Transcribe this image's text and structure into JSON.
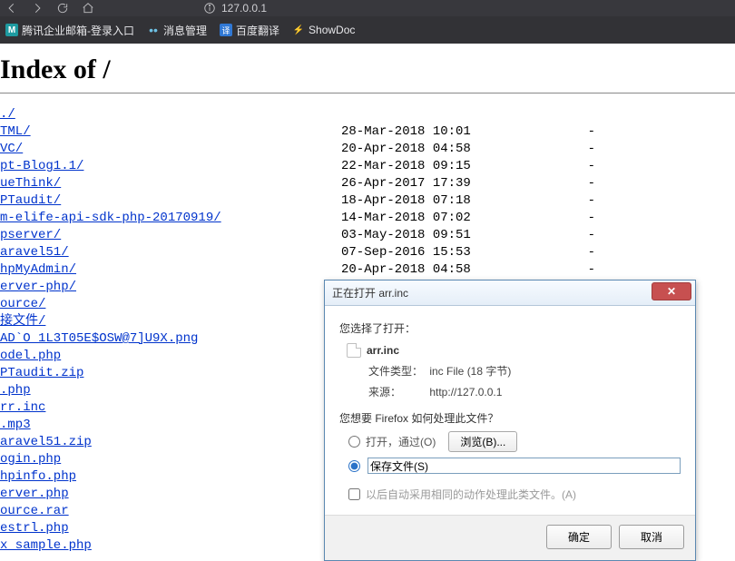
{
  "browser": {
    "address": "127.0.0.1",
    "bookmarks": [
      {
        "icon": "cyan",
        "iconText": "M",
        "label": "腾讯企业邮箱-登录入口"
      },
      {
        "icon": "dots",
        "iconText": "••",
        "label": "消息管理"
      },
      {
        "icon": "yi",
        "iconText": "译",
        "label": "百度翻译"
      },
      {
        "icon": "bolt",
        "iconText": "⚡",
        "label": "ShowDoc"
      }
    ]
  },
  "page": {
    "title": "Index of /",
    "entries": [
      {
        "name": "./",
        "date": "",
        "size": ""
      },
      {
        "name": "TML/",
        "date": "28-Mar-2018 10:01",
        "size": "-"
      },
      {
        "name": "VC/",
        "date": "20-Apr-2018 04:58",
        "size": "-"
      },
      {
        "name": "pt-Blog1.1/",
        "date": "22-Mar-2018 09:15",
        "size": "-"
      },
      {
        "name": "ueThink/",
        "date": "26-Apr-2017 17:39",
        "size": "-"
      },
      {
        "name": "PTaudit/",
        "date": "18-Apr-2018 07:18",
        "size": "-"
      },
      {
        "name": "m-elife-api-sdk-php-20170919/",
        "date": "14-Mar-2018 07:02",
        "size": "-"
      },
      {
        "name": "pserver/",
        "date": "03-May-2018 09:51",
        "size": "-"
      },
      {
        "name": "aravel51/",
        "date": "07-Sep-2016 15:53",
        "size": "-"
      },
      {
        "name": "hpMyAdmin/",
        "date": "20-Apr-2018 04:58",
        "size": "-"
      },
      {
        "name": "erver-php/",
        "date": "",
        "size": ""
      },
      {
        "name": "ource/",
        "date": "",
        "size": ""
      },
      {
        "name": "接文件/",
        "date": "",
        "size": ""
      },
      {
        "name": "AD`O_1L3T05E$OSW@7]U9X.png",
        "date": "",
        "size": ""
      },
      {
        "name": "odel.php",
        "date": "",
        "size": ""
      },
      {
        "name": "PTaudit.zip",
        "date": "",
        "size": ""
      },
      {
        "name": ".php",
        "date": "",
        "size": ""
      },
      {
        "name": "rr.inc",
        "date": "",
        "size": ""
      },
      {
        "name": ".mp3",
        "date": "",
        "size": ""
      },
      {
        "name": "aravel51.zip",
        "date": "",
        "size": ""
      },
      {
        "name": "ogin.php",
        "date": "",
        "size": ""
      },
      {
        "name": "hpinfo.php",
        "date": "",
        "size": ""
      },
      {
        "name": "erver.php",
        "date": "",
        "size": ""
      },
      {
        "name": "ource.rar",
        "date": "",
        "size": ""
      },
      {
        "name": "estrl.php",
        "date": "",
        "size": ""
      },
      {
        "name": "x_sample.php",
        "date": "",
        "size": ""
      }
    ]
  },
  "dialog": {
    "title": "正在打开 arr.inc",
    "youChose": "您选择了打开：",
    "filename": "arr.inc",
    "fileTypeLabel": "文件类型：",
    "fileTypeValue": "inc File (18 字节)",
    "sourceLabel": "来源：",
    "sourceValue": "http://127.0.0.1",
    "question": "您想要 Firefox 如何处理此文件？",
    "openWith": "打开，通过(O)",
    "browse": "浏览(B)...",
    "saveFile": "保存文件(S)",
    "remember": "以后自动采用相同的动作处理此类文件。(A)",
    "ok": "确定",
    "cancel": "取消"
  }
}
